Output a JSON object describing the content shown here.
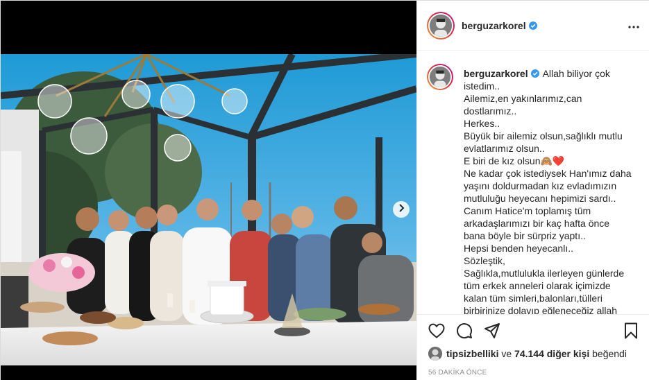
{
  "post": {
    "username": "berguzarkorel",
    "verified": true,
    "more_icon": "more-horizontal-icon",
    "next_icon": "chevron-right-icon"
  },
  "caption": {
    "username": "berguzarkorel",
    "lines": [
      "Allah biliyor çok",
      "istedim..",
      "Ailemiz,en yakınlarımız,can",
      "dostlarımız..",
      "Herkes..",
      "Büyük bir ailemiz olsun,sağlıklı mutlu",
      "evlatlarımız olsun..",
      "E biri de kız olsun🙈❤️",
      "Ne kadar çok istediysek Han'ımız daha",
      "yaşını doldurmadan kız evladımızın",
      "mutluluğu heyecanı hepimizi sardı..",
      "Canım Hatice'm toplamış tüm",
      "arkadaşlarımızı bir kaç hafta önce",
      "bana böyle bir sürpriz yaptı..",
      "Hepsi benden heyecanlı..",
      "Sözleştik,",
      "Sağlıkla,mutlulukla ilerleyen günlerde",
      "tüm erkek anneleri olarak içimizde",
      "kalan tüm simleri,balonları,tülleri",
      "birbirinize dolayıp eğleneceğiz allah"
    ]
  },
  "actions": {
    "like_icon": "heart-icon",
    "comment_icon": "comment-icon",
    "share_icon": "share-icon",
    "save_icon": "bookmark-icon"
  },
  "likes": {
    "first_user": "tipsizbelliki",
    "connector": " ve ",
    "count_text": "74.144 diğer kişi",
    "suffix": " beğendi"
  },
  "timestamp": "56 DAKİKA ÖNCE",
  "colors": {
    "verified_blue": "#3897f0",
    "text": "#262626",
    "secondary_text": "#8e8e8e",
    "border": "#dbdbdb"
  }
}
